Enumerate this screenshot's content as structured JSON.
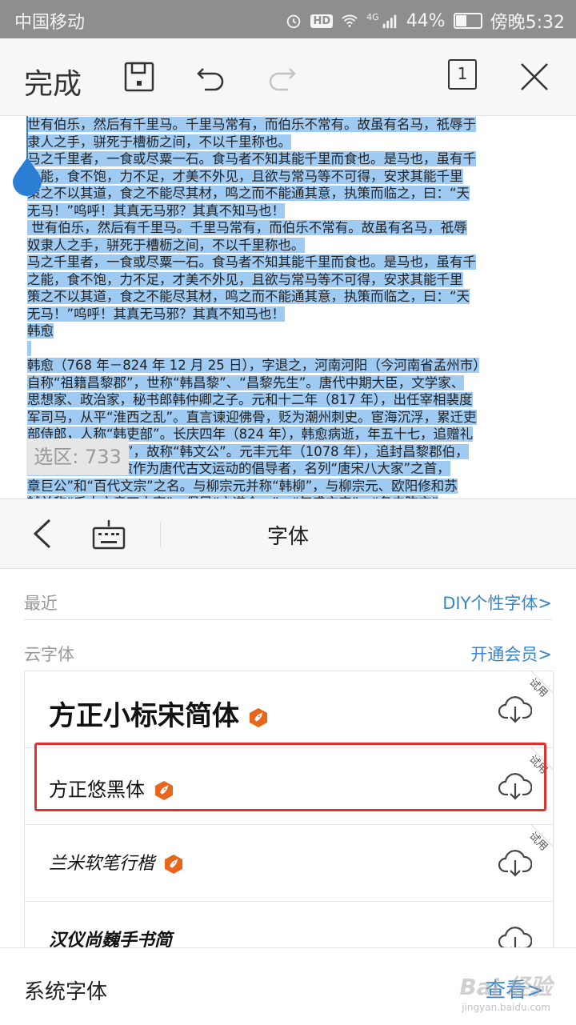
{
  "status_bar": {
    "carrier": "中国移动",
    "network": "4G",
    "battery_percent": "44%",
    "time": "傍晚5:32",
    "icons": [
      "alarm-icon",
      "hd-icon",
      "wifi-icon",
      "signal-icon",
      "battery-icon"
    ]
  },
  "toolbar": {
    "done_label": "完成",
    "page_count": "1",
    "icons": [
      "save-icon",
      "undo-icon",
      "redo-icon",
      "page-icon",
      "close-icon"
    ]
  },
  "document": {
    "lines": [
      "世有伯乐，然后有千里马。千里马常有，而伯乐不常有。故虽有名马，祇辱于奴",
      "隶人之手，骈死于槽枥之间，不以千里称也。",
      "马之千里者，一食或尽粟一石。食马者不知其能千里而食也。是马也，虽有千里",
      "之能，食不饱，力不足，才美不外见，且欲与常马等不可得，安求其能千里也？",
      "策之不以其道，食之不能尽其材，鸣之而不能通其意，执策而临之，曰：“天下",
      "无马！”呜呼！其真无马邪？其真不知马也！",
      " 世有伯乐，然后有千里马。千里马常有，而伯乐不常有。故虽有名马，祇辱于",
      "奴隶人之手，骈死于槽枥之间，不以千里称也。",
      "马之千里者，一食或尽粟一石。食马者不知其能千里而食也。是马也，虽有千里",
      "之能，食不饱，力不足，才美不外见，且欲与常马等不可得，安求其能千里也？",
      "策之不以其道，食之不能尽其材，鸣之而不能通其意，执策而临之，曰：“天下",
      "无马！”呜呼！其真无马邪？其真不知马也！",
      "韩愈",
      "",
      "韩愈（768 年－824 年 12 月 25 日），字退之，河南河阳（今河南省孟州市）人，",
      "自称“祖籍昌黎郡”，世称“韩昌黎”、“昌黎先生”。唐代中期大臣，文学家、",
      "思想家、政治家，秘书郎韩仲卿之子。元和十二年（817 年），出任宰相裴度行",
      "军司马，从平“淮西之乱”。直言谏迎佛骨，贬为潮州刺史。宦海沉浮，累迁吏",
      "部侍郎，人称“韩吏部”。长庆四年（824 年），韩愈病逝，年五十七，追赠礼",
      "部尚书，谥号“文”，故称“韩文公”。元丰元年（1078 年），追封昌黎郡伯，",
      "并从祀孔庙。韩愈作为唐代古文运动的倡导者，名列“唐宋八大家”之首，有“文",
      "章巨公”和“百代文宗”之名。与柳宗元并称“韩柳”，与柳宗元、欧阳修和苏",
      "轼并称“千古文章四大家”。倡导“文道合一”、“气盛言宜”、“务去陈言”"
    ],
    "selection_label": "选区:",
    "selection_count": "733"
  },
  "font_panel": {
    "title": "字体",
    "recent_label": "最近",
    "diy_link": "DIY个性字体>",
    "cloud_label": "云字体",
    "vip_link": "开通会员>",
    "fonts": [
      {
        "name": "方正小标宋简体",
        "trial": "试用",
        "vip": true
      },
      {
        "name": "方正悠黑体",
        "trial": "试用",
        "vip": true
      },
      {
        "name": "兰米软笔行楷",
        "trial": "试用",
        "vip": true
      },
      {
        "name": "汉仪尚巍手书简",
        "trial": "",
        "vip": false
      }
    ],
    "system_fonts_label": "系统字体",
    "view_link": "查看>"
  },
  "watermark": {
    "text": "Bai 经验",
    "sub": "jingyan.baidu.com"
  },
  "colors": {
    "selection": "#9fcaf2",
    "link": "#3a85c9",
    "vip_badge": "#e8661c",
    "highlight": "#e0312f",
    "status_bar": "#8e8e8e"
  }
}
